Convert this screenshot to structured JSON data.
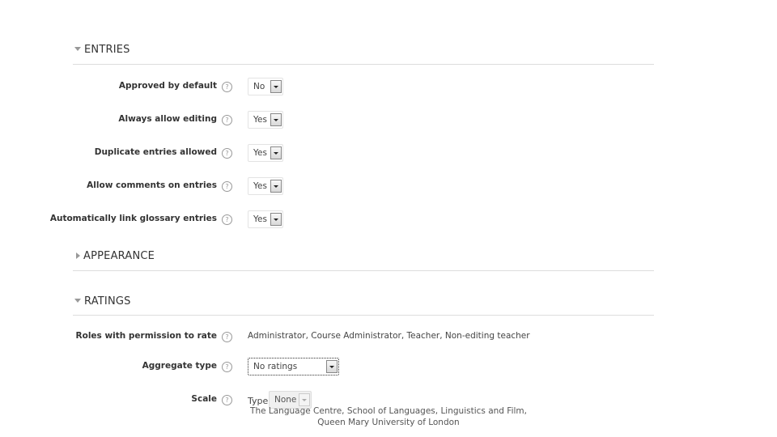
{
  "sections": {
    "entries": {
      "title": "ENTRIES",
      "expanded": true
    },
    "appearance": {
      "title": "APPEARANCE",
      "expanded": false
    },
    "ratings": {
      "title": "RATINGS",
      "expanded": true
    }
  },
  "entries_fields": [
    {
      "label": "Approved by default",
      "value": "No"
    },
    {
      "label": "Always allow editing",
      "value": "Yes"
    },
    {
      "label": "Duplicate entries allowed",
      "value": "Yes"
    },
    {
      "label": "Allow comments on entries",
      "value": "Yes"
    },
    {
      "label": "Automatically link glossary entries",
      "value": "Yes"
    }
  ],
  "ratings_fields": {
    "roles": {
      "label": "Roles with permission to rate",
      "value": "Administrator, Course Administrator, Teacher, Non-editing teacher"
    },
    "aggregate": {
      "label": "Aggregate type",
      "value": "No ratings"
    },
    "scale": {
      "label": "Scale",
      "type_label": "Type",
      "value": "None"
    }
  },
  "help_icon_glyph": "?",
  "footer": {
    "line1": "The Language Centre, School of Languages, Linguistics and Film,",
    "line2": "Queen Mary University of London"
  }
}
